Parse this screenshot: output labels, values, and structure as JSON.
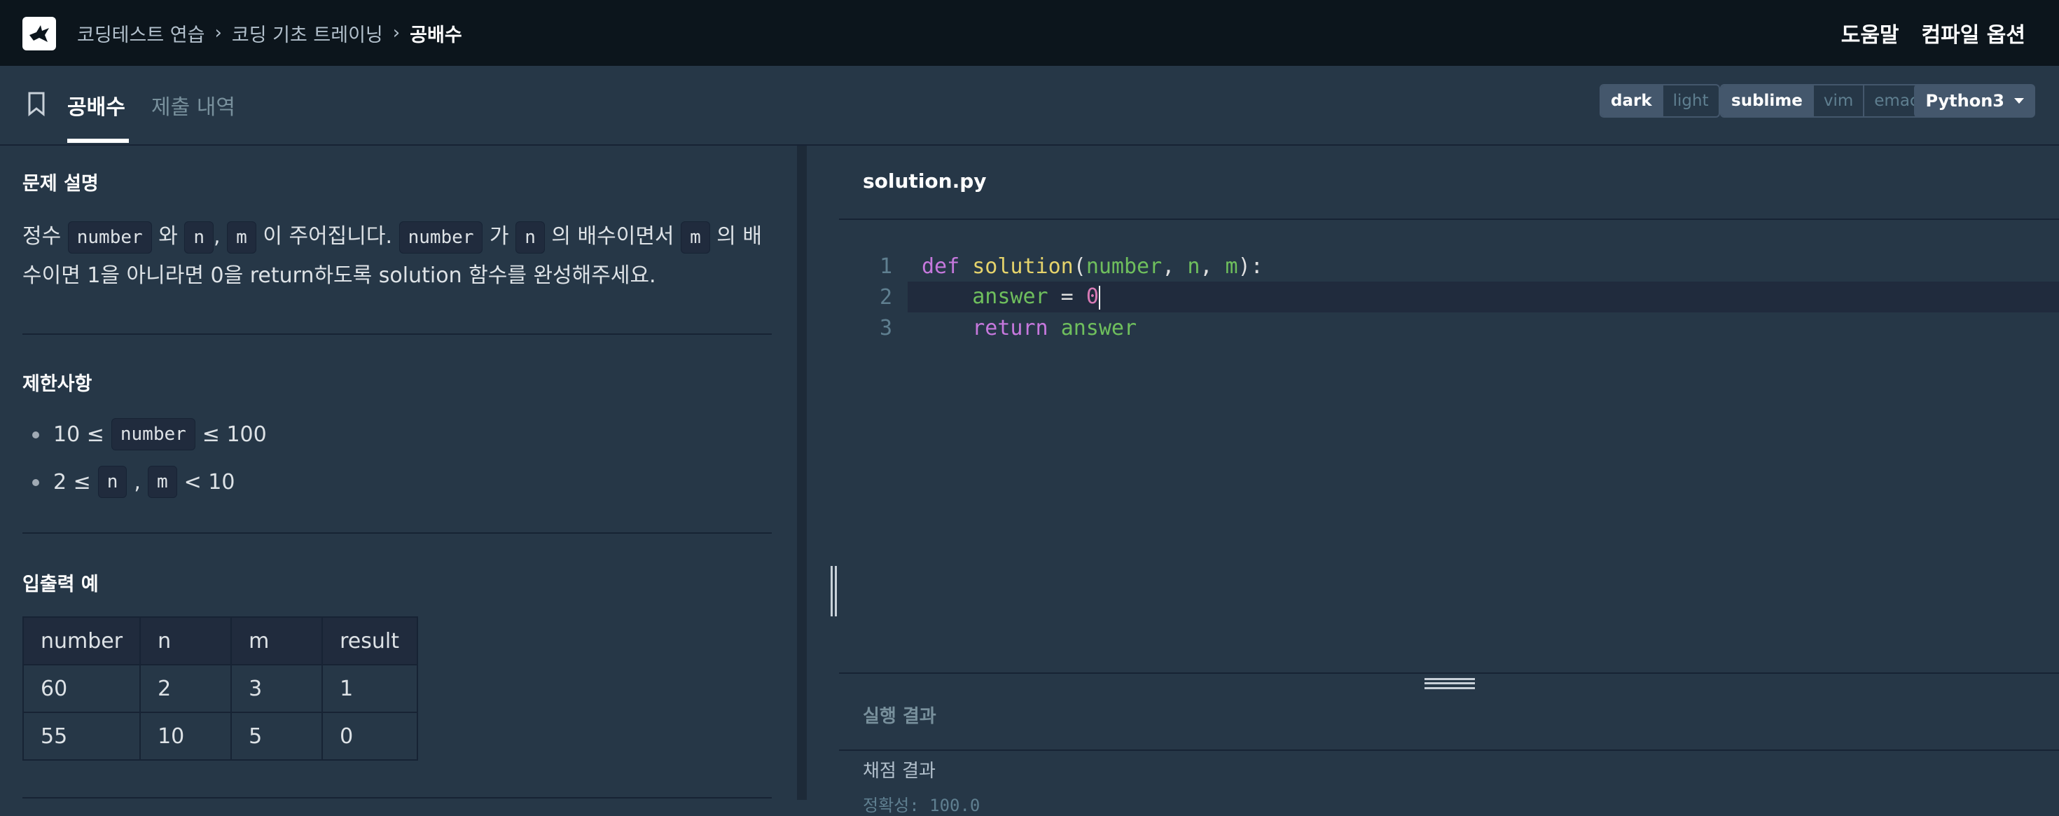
{
  "nav": {
    "breadcrumb": [
      "코딩테스트 연습",
      "코딩 기초 트레이닝",
      "공배수"
    ],
    "help_label": "도움말",
    "compile_options_label": "컴파일 옵션"
  },
  "tabs": {
    "active": "공배수",
    "submissions": "제출 내역"
  },
  "editor_options": {
    "themes": [
      "dark",
      "light"
    ],
    "selected_theme": "dark",
    "keymaps": [
      "sublime",
      "vim",
      "emacs"
    ],
    "selected_keymap": "sublime",
    "language": "Python3"
  },
  "problem": {
    "description_title": "문제 설명",
    "description": {
      "p1": "정수",
      "c1": "number",
      "p2": "와",
      "c2": "n",
      "p3": ",",
      "c3": "m",
      "p4": "이 주어집니다.",
      "c4": "number",
      "p5": "가",
      "c5": "n",
      "p6": "의 배수이면서",
      "c6": "m",
      "p7": "의 배수이면 1을 아니라면 0을 return하도록 solution 함수를 완성해주세요."
    },
    "constraints_title": "제한사항",
    "constraints": [
      {
        "before": "10 ≤",
        "code": "number",
        "after": "≤ 100"
      },
      {
        "before": "2 ≤",
        "code": "n",
        "mid": ",",
        "code2": "m",
        "after": "< 10"
      }
    ],
    "io_title": "입출력 예",
    "io_table": {
      "headers": [
        "number",
        "n",
        "m",
        "result"
      ],
      "rows": [
        [
          "60",
          "2",
          "3",
          "1"
        ],
        [
          "55",
          "10",
          "5",
          "0"
        ]
      ]
    }
  },
  "code_editor": {
    "filename": "solution.py",
    "line_numbers": [
      "1",
      "2",
      "3"
    ],
    "lines": {
      "l1": {
        "kw": "def",
        "fn": "solution",
        "open": "(",
        "p1": "number",
        "c1": ", ",
        "p2": "n",
        "c2": ", ",
        "p3": "m",
        "close": "):"
      },
      "l2": {
        "indent": "    ",
        "var": "answer",
        "op": " = ",
        "num": "0"
      },
      "l3": {
        "indent": "    ",
        "kw": "return",
        "var": "answer"
      }
    }
  },
  "results": {
    "run_result_title": "실행 결과",
    "grading_result_label": "채점 결과",
    "accuracy_text": "정확성: 100.0"
  }
}
